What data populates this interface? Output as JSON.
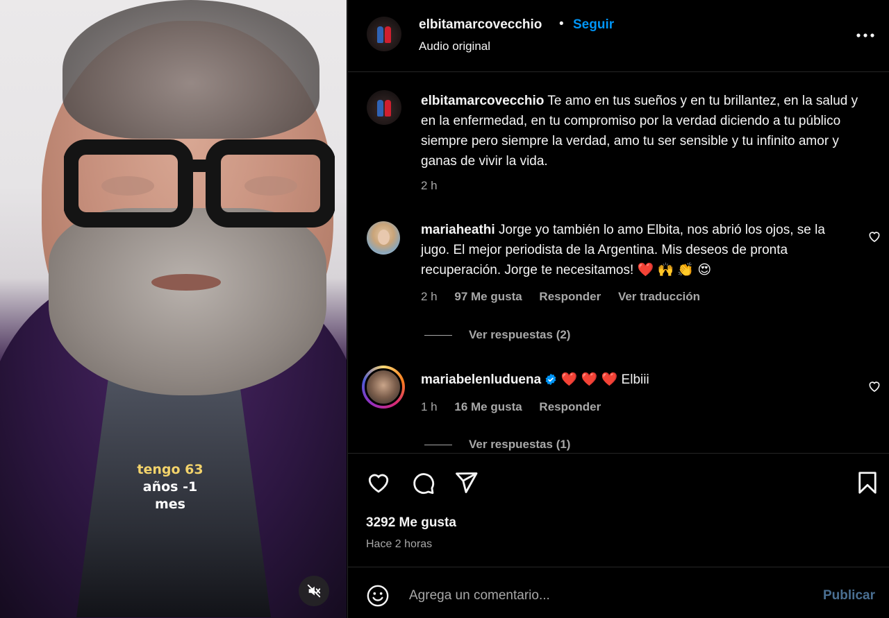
{
  "video": {
    "caption_line1": "tengo 63",
    "caption_line2": "años -1",
    "caption_line3": "mes",
    "mute_icon": "speaker-muted-icon"
  },
  "header": {
    "username": "elbitamarcovecchio",
    "separator": "•",
    "follow_label": "Seguir",
    "audio_label": "Audio original",
    "more_icon": "more-horizontal-icon"
  },
  "caption_comment": {
    "username": "elbitamarcovecchio",
    "text": "Te amo en tus sueños y en tu brillantez, en la salud y en la enfermedad, en tu compromiso por la verdad diciendo a tu público siempre pero siempre la verdad, amo tu ser sensible y tu infinito amor y ganas de vivir la vida.",
    "time": "2 h"
  },
  "comments": [
    {
      "username": "mariaheathi",
      "text": "Jorge yo también lo amo Elbita, nos abrió los ojos, se la jugo. El mejor periodista de la Argentina. Mis deseos de pronta recuperación. Jorge te necesitamos!",
      "emojis": "❤️ 🙌 👏 😍",
      "time": "2 h",
      "likes": "97 Me gusta",
      "reply_label": "Responder",
      "translate_label": "Ver traducción",
      "view_replies": "Ver respuestas (2)"
    },
    {
      "username": "mariabelenluduena",
      "hearts": "❤️ ❤️ ❤️",
      "text": "Elbiii",
      "time": "1 h",
      "likes": "16 Me gusta",
      "reply_label": "Responder",
      "view_replies": "Ver respuestas (1)"
    }
  ],
  "actions": {
    "likes": "3292 Me gusta",
    "time": "Hace 2 horas"
  },
  "comment_box": {
    "placeholder": "Agrega un comentario...",
    "publish_label": "Publicar"
  },
  "colors": {
    "accent": "#0095f6",
    "muted_text": "#a8a8a8",
    "background": "#000000",
    "publish_disabled": "#4a6f92"
  }
}
